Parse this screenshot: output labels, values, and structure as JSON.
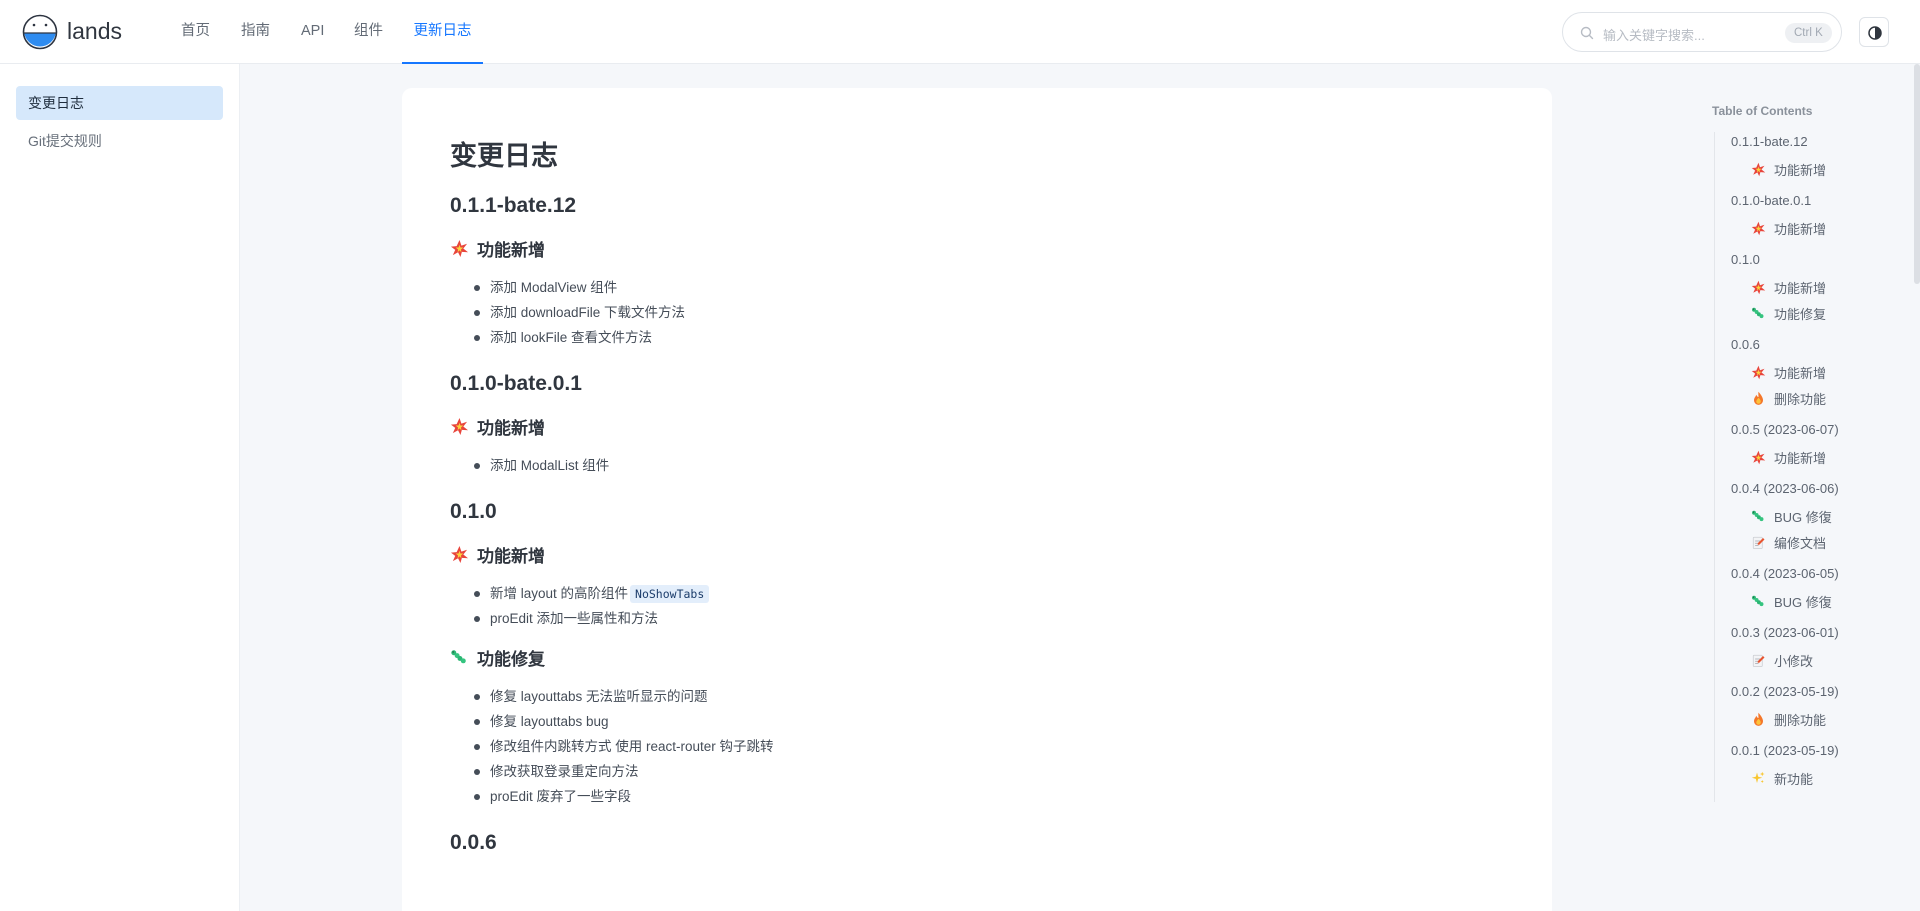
{
  "brand": {
    "name": "lands"
  },
  "nav": [
    {
      "label": "首页",
      "active": false
    },
    {
      "label": "指南",
      "active": false
    },
    {
      "label": "API",
      "active": false
    },
    {
      "label": "组件",
      "active": false
    },
    {
      "label": "更新日志",
      "active": true
    }
  ],
  "search": {
    "placeholder": "输入关键字搜索...",
    "shortcut": "Ctrl K"
  },
  "theme_toggle_icon": "contrast-icon",
  "sidebar": {
    "items": [
      {
        "label": "变更日志",
        "active": true
      },
      {
        "label": "Git提交规则",
        "active": false
      }
    ]
  },
  "content": {
    "title": "变更日志",
    "sections": [
      {
        "version": "0.1.1-bate.12",
        "groups": [
          {
            "icon": "sparkle-burst-icon",
            "heading": "功能新增",
            "items": [
              {
                "text": "添加 ModalView 组件"
              },
              {
                "text": "添加 downloadFile 下载文件方法"
              },
              {
                "text": "添加 lookFile 查看文件方法"
              }
            ]
          }
        ]
      },
      {
        "version": "0.1.0-bate.0.1",
        "groups": [
          {
            "icon": "sparkle-burst-icon",
            "heading": "功能新增",
            "items": [
              {
                "text": "添加 ModalList 组件"
              }
            ]
          }
        ]
      },
      {
        "version": "0.1.0",
        "groups": [
          {
            "icon": "sparkle-burst-icon",
            "heading": "功能新增",
            "items": [
              {
                "text": "新增 layout 的高阶组件",
                "code": "NoShowTabs"
              },
              {
                "text": "proEdit 添加一些属性和方法"
              }
            ]
          },
          {
            "icon": "caterpillar-icon",
            "heading": "功能修复",
            "items": [
              {
                "text": "修复 layouttabs 无法监听显示的问题"
              },
              {
                "text": "修复 layouttabs bug"
              },
              {
                "text": "修改组件内跳转方式 使用 react-router 钩子跳转"
              },
              {
                "text": "修改获取登录重定向方法"
              },
              {
                "text": "proEdit 废弃了一些字段"
              }
            ]
          }
        ]
      },
      {
        "version": "0.0.6",
        "groups": []
      }
    ]
  },
  "toc": {
    "title": "Table of Contents",
    "entries": [
      {
        "label": "0.1.1-bate.12",
        "children": [
          {
            "icon": "sparkle-burst-icon",
            "label": "功能新增"
          }
        ]
      },
      {
        "label": "0.1.0-bate.0.1",
        "children": [
          {
            "icon": "sparkle-burst-icon",
            "label": "功能新增"
          }
        ]
      },
      {
        "label": "0.1.0",
        "children": [
          {
            "icon": "sparkle-burst-icon",
            "label": "功能新增"
          },
          {
            "icon": "caterpillar-icon",
            "label": "功能修复"
          }
        ]
      },
      {
        "label": "0.0.6",
        "children": [
          {
            "icon": "sparkle-burst-icon",
            "label": "功能新增"
          },
          {
            "icon": "fire-icon",
            "label": "删除功能"
          }
        ]
      },
      {
        "label": "0.0.5 (2023-06-07)",
        "children": [
          {
            "icon": "sparkle-burst-icon",
            "label": "功能新增"
          }
        ]
      },
      {
        "label": "0.0.4 (2023-06-06)",
        "children": [
          {
            "icon": "caterpillar-icon",
            "label": "BUG 修復"
          },
          {
            "icon": "memo-icon",
            "label": "编修文档"
          }
        ]
      },
      {
        "label": "0.0.4 (2023-06-05)",
        "children": [
          {
            "icon": "caterpillar-icon",
            "label": "BUG 修復"
          }
        ]
      },
      {
        "label": "0.0.3 (2023-06-01)",
        "children": [
          {
            "icon": "memo-icon",
            "label": "小修改"
          }
        ]
      },
      {
        "label": "0.0.2 (2023-05-19)",
        "children": [
          {
            "icon": "fire-icon",
            "label": "删除功能"
          }
        ]
      },
      {
        "label": "0.0.1 (2023-05-19)",
        "children": [
          {
            "icon": "sparkles-icon",
            "label": "新功能"
          }
        ]
      }
    ]
  },
  "colors": {
    "accent": "#1677ff",
    "active_bg": "#d6e8fb",
    "page_bg": "#f5f7fa"
  }
}
